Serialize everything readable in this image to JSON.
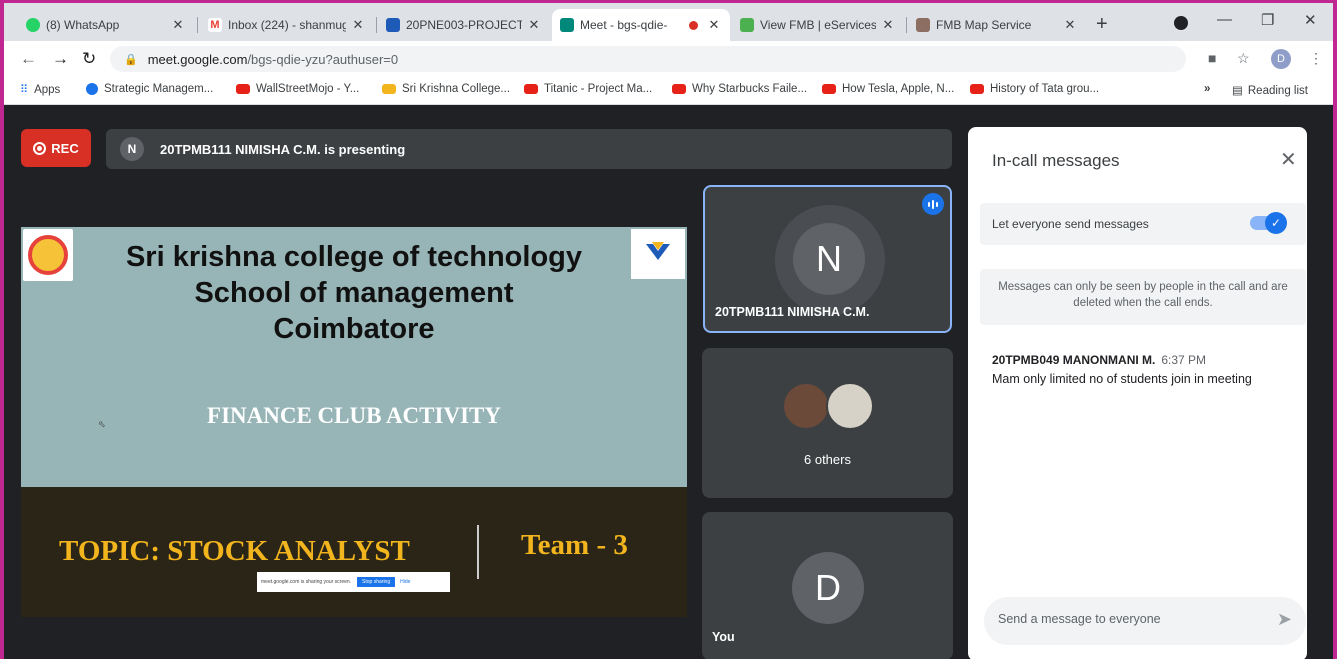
{
  "browser": {
    "tabs": [
      {
        "title": "(8) WhatsApp",
        "icon": "whatsapp-icon",
        "color": "#25d366"
      },
      {
        "title": "Inbox (224) - shanmug",
        "icon": "gmail-icon",
        "color": "#ea4335"
      },
      {
        "title": "20PNE003-PROJECT A",
        "icon": "classroom-icon",
        "color": "#1e5bb8"
      },
      {
        "title": "Meet - bgs-qdie-",
        "icon": "meet-icon",
        "color": "#00897b"
      },
      {
        "title": "View FMB | eServices",
        "icon": "eservices-icon",
        "color": "#4caf50"
      },
      {
        "title": "FMB Map Service",
        "icon": "map-service-icon",
        "color": "#8d6e63"
      }
    ],
    "url_host": "meet.google.com",
    "url_path": "/bgs-qdie-yzu?authuser=0",
    "profile_initial": "D",
    "bookmarks": [
      {
        "label": "Apps"
      },
      {
        "label": "Strategic Managem..."
      },
      {
        "label": "WallStreetMojo - Y..."
      },
      {
        "label": "Sri Krishna College..."
      },
      {
        "label": "Titanic - Project Ma..."
      },
      {
        "label": "Why Starbucks Faile..."
      },
      {
        "label": "How Tesla, Apple, N..."
      },
      {
        "label": "History of Tata grou..."
      }
    ],
    "bookmarks_more": "»",
    "reading_list": "Reading list"
  },
  "meet": {
    "rec_label": "REC",
    "presenter_initial": "N",
    "presenting_text": "20TPMB111 NIMISHA C.M. is presenting",
    "slide": {
      "title_line1": "Sri krishna college of technology",
      "title_line2": "School of management",
      "title_line3": "Coimbatore",
      "activity": "FINANCE CLUB ACTIVITY",
      "topic": "TOPIC: STOCK ANALYST",
      "team": "Team - 3",
      "share_text": "meet.google.com is sharing your screen.",
      "stop_sharing": "Stop sharing",
      "hide": "Hide"
    },
    "tiles": {
      "presenter_initial": "N",
      "presenter_name": "20TPMB111 NIMISHA C.M.",
      "others_label": "6 others",
      "you_initial": "D",
      "you_label": "You"
    },
    "chat": {
      "title": "In-call messages",
      "let_everyone": "Let everyone send messages",
      "notice": "Messages can only be seen by people in the call and are deleted when the call ends.",
      "sender": "20TPMB049 MANONMANI M.",
      "time": "6:37 PM",
      "message": "Mam only limited no of students join in meeting",
      "placeholder": "Send a message to everyone"
    }
  }
}
